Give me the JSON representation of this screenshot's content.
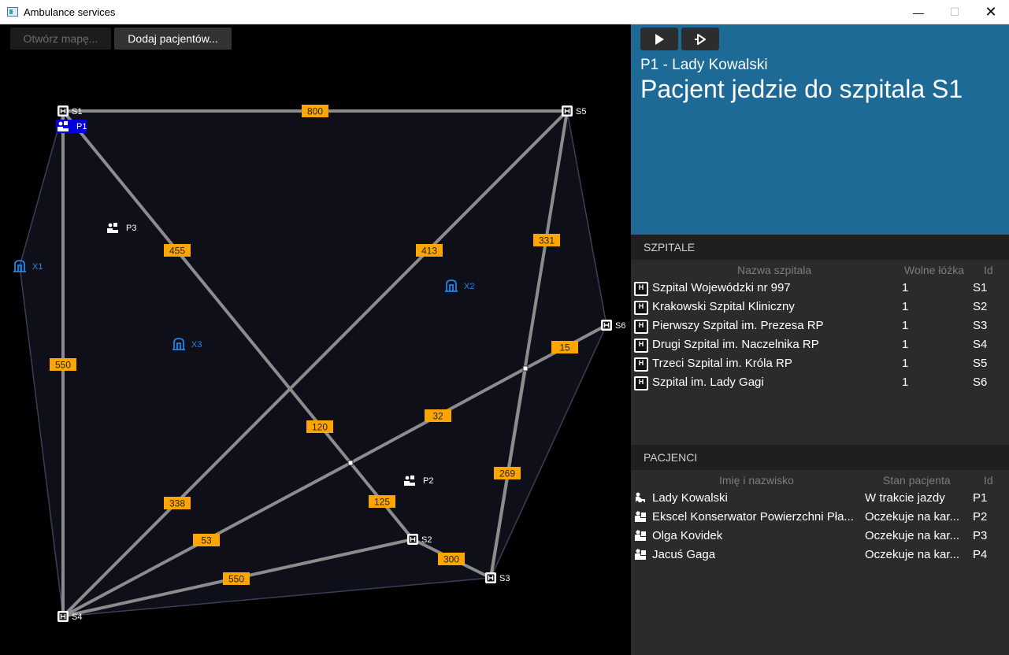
{
  "window": {
    "title": "Ambulance services"
  },
  "toolbar": {
    "open_map": "Otwórz mapę...",
    "add_patients": "Dodaj pacjentów..."
  },
  "status": {
    "subtitle": "P1 - Lady Kowalski",
    "main": "Pacjent jedzie do szpitala S1"
  },
  "hospitals": {
    "header": "SZPITALE",
    "columns": [
      "Nazwa szpitala",
      "Wolne łóżka",
      "Id"
    ],
    "rows": [
      {
        "name": "Szpital Wojewódzki nr 997",
        "beds": "1",
        "id": "S1"
      },
      {
        "name": "Krakowski Szpital Kliniczny",
        "beds": "1",
        "id": "S2"
      },
      {
        "name": "Pierwszy Szpital im. Prezesa RP",
        "beds": "1",
        "id": "S3"
      },
      {
        "name": "Drugi Szpital im. Naczelnika RP",
        "beds": "1",
        "id": "S4"
      },
      {
        "name": "Trzeci Szpital im. Króla RP",
        "beds": "1",
        "id": "S5"
      },
      {
        "name": "Szpital im. Lady Gagi",
        "beds": "1",
        "id": "S6"
      }
    ]
  },
  "patients": {
    "header": "PACJENCI",
    "columns": [
      "Imię i nazwisko",
      "Stan pacjenta",
      "Id"
    ],
    "rows": [
      {
        "name": "Lady Kowalski",
        "state": "W trakcie jazdy",
        "id": "P1",
        "icon": "ambulance-icon"
      },
      {
        "name": "Ekscel Konserwator Powierzchni Pła...",
        "state": "Oczekuje na kar...",
        "id": "P2",
        "icon": "patient-icon"
      },
      {
        "name": "Olga Kovidek",
        "state": "Oczekuje na kar...",
        "id": "P3",
        "icon": "patient-icon"
      },
      {
        "name": "Jacuś Gaga",
        "state": "Oczekuje na kar...",
        "id": "P4",
        "icon": "patient-icon"
      }
    ]
  },
  "map": {
    "node_labels": {
      "S1": "S1",
      "S2": "S2",
      "S3": "S3",
      "S4": "S4",
      "S5": "S5",
      "S6": "S6"
    },
    "patient_labels": {
      "P1": "P1",
      "P2": "P2",
      "P3": "P3"
    },
    "landmark_labels": {
      "X1": "X1",
      "X2": "X2",
      "X3": "X3"
    },
    "edges": [
      {
        "from": "S1",
        "to": "S5",
        "weight": "800"
      },
      {
        "from": "S1",
        "to": "J1",
        "weight": "455"
      },
      {
        "from": "J1",
        "to": "S2",
        "weight": "125"
      },
      {
        "from": "S1",
        "to": "S4",
        "weight": "550"
      },
      {
        "from": "S4",
        "to": "S5",
        "weight": "413"
      },
      {
        "from": "S5",
        "to": "S3",
        "weight": "331"
      },
      {
        "from": "S6",
        "to": "J2",
        "weight": "15"
      },
      {
        "from": "J2",
        "to": "J1",
        "weight": "32"
      },
      {
        "from": "J2",
        "to": "S3",
        "weight": "269"
      },
      {
        "from": "J1",
        "to": "S4",
        "weight": "53"
      },
      {
        "from": "S4",
        "to": "S2",
        "weight": "550"
      },
      {
        "from": "S2",
        "to": "S3",
        "weight": "300"
      },
      {
        "from": "S4",
        "to": "S5",
        "weight": "338"
      },
      {
        "from": "S1",
        "to": "J1",
        "weight": "120"
      }
    ],
    "colors": {
      "edge": "#8c8c8c",
      "label_bg": "#ffa500",
      "selected": "#0000dd",
      "landmark": "#1e88e5",
      "hull_fill": "#0f0f1a",
      "hull_stroke": "#3a3f55"
    }
  }
}
